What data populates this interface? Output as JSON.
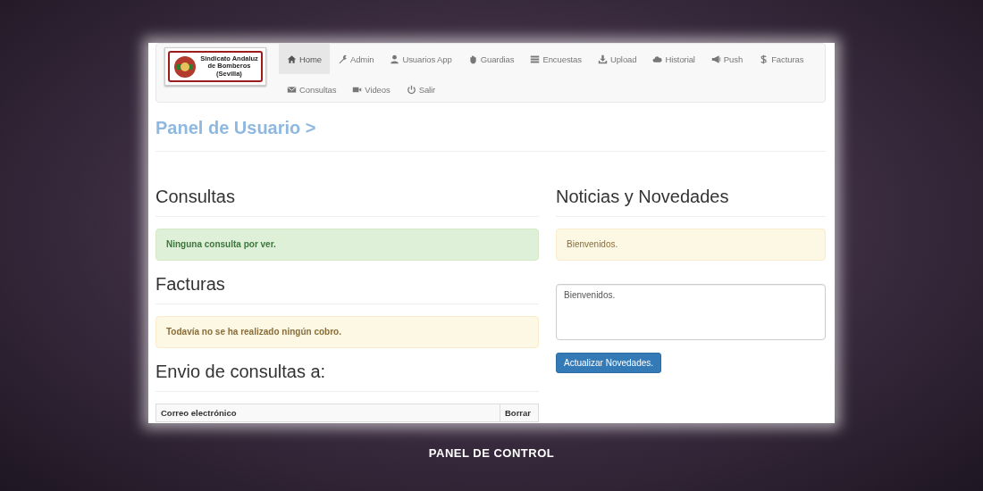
{
  "logo": {
    "lines": [
      "Sindicato Andaluz",
      "de Bomberos",
      "(Sevilla)"
    ]
  },
  "nav": [
    {
      "label": "Home",
      "selected": true
    },
    {
      "label": "Admin",
      "selected": false
    },
    {
      "label": "Usuarios App",
      "selected": false
    },
    {
      "label": "Guardias",
      "selected": false
    },
    {
      "label": "Encuestas",
      "selected": false
    },
    {
      "label": "Upload",
      "selected": false
    },
    {
      "label": "Historial",
      "selected": false
    },
    {
      "label": "Push",
      "selected": false
    },
    {
      "label": "Facturas",
      "selected": false
    },
    {
      "label": "Consultas",
      "selected": false
    },
    {
      "label": "Videos",
      "selected": false
    },
    {
      "label": "Salir",
      "selected": false
    }
  ],
  "page_title": "Panel de Usuario >",
  "left": [
    {
      "kind": "alert",
      "heading": "Consultas",
      "alert": {
        "kind": "success",
        "text": "Ninguna consulta por ver."
      }
    },
    {
      "kind": "alert",
      "heading": "Facturas",
      "alert": {
        "kind": "warning",
        "text": "Todavía no se ha realizado ningún cobro."
      }
    },
    {
      "kind": "table",
      "heading": "Envio de consultas a:",
      "columns": [
        "Correo electrónico",
        "Borrar"
      ]
    }
  ],
  "right": {
    "heading": "Noticias y Novedades",
    "alert": {
      "kind": "notice",
      "text": "Bienvenidos."
    },
    "textarea_value": "Bienvenidos.",
    "button": "Actualizar Novedades."
  },
  "caption": "PANEL DE CONTROL"
}
